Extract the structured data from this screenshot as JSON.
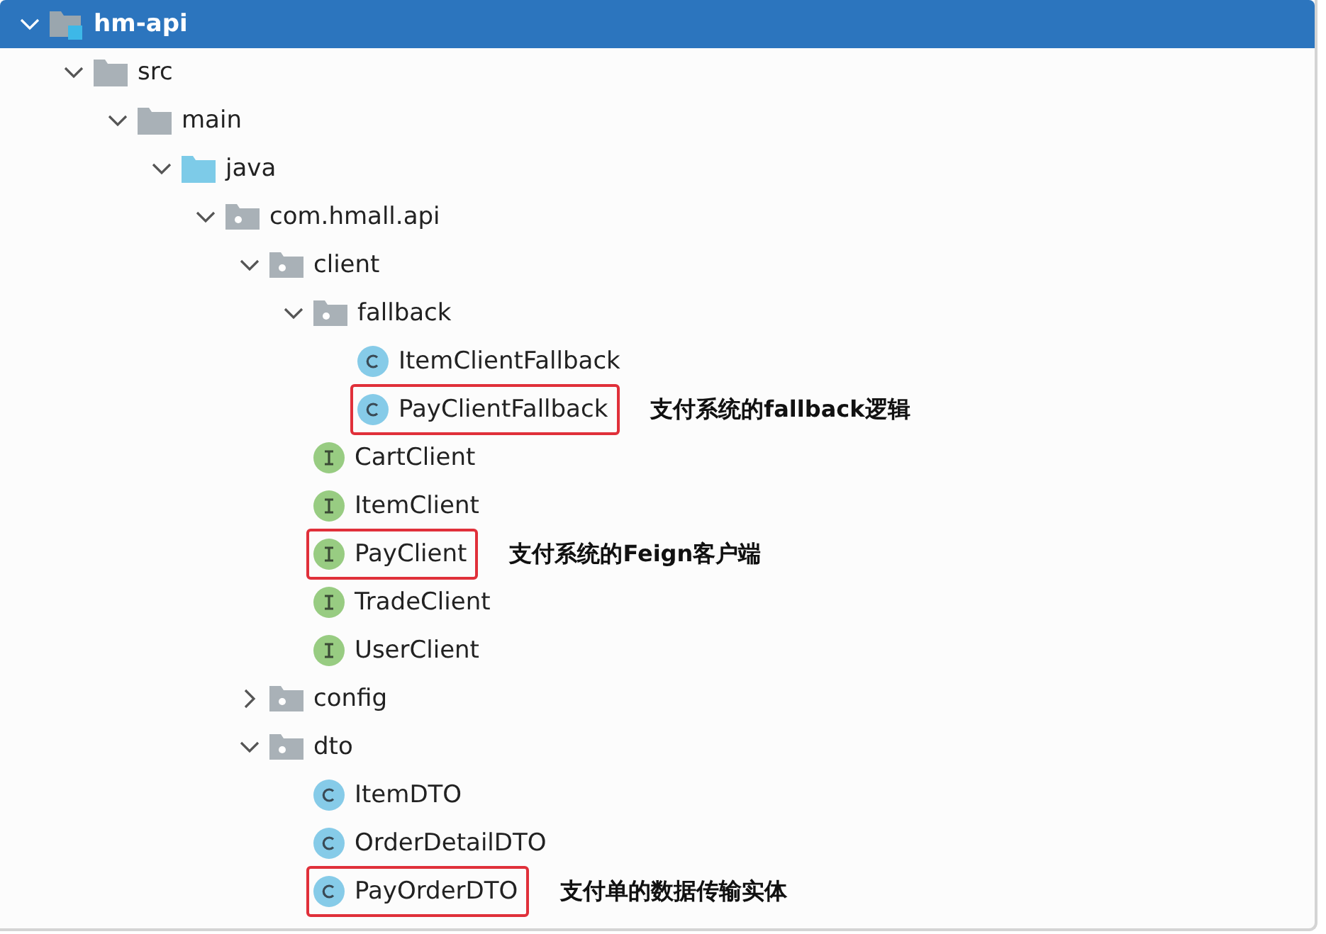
{
  "tree": [
    {
      "label": "hm-api",
      "kind": "module",
      "expanded": true,
      "selected": true,
      "children": [
        {
          "label": "src",
          "kind": "folder",
          "expanded": true,
          "selected": false,
          "children": [
            {
              "label": "main",
              "kind": "folder",
              "expanded": true,
              "selected": false,
              "children": [
                {
                  "label": "java",
                  "kind": "source",
                  "expanded": true,
                  "selected": false,
                  "children": [
                    {
                      "label": "com.hmall.api",
                      "kind": "package",
                      "expanded": true,
                      "selected": false,
                      "children": [
                        {
                          "label": "client",
                          "kind": "package",
                          "expanded": true,
                          "selected": false,
                          "children": [
                            {
                              "label": "fallback",
                              "kind": "package",
                              "expanded": true,
                              "selected": false,
                              "children": [
                                {
                                  "label": "ItemClientFallback",
                                  "kind": "class",
                                  "selected": false,
                                  "highlighted": false
                                },
                                {
                                  "label": "PayClientFallback",
                                  "kind": "class",
                                  "selected": false,
                                  "highlighted": true,
                                  "note": "支付系统的fallback逻辑"
                                }
                              ]
                            },
                            {
                              "label": "CartClient",
                              "kind": "interface",
                              "selected": false,
                              "highlighted": false
                            },
                            {
                              "label": "ItemClient",
                              "kind": "interface",
                              "selected": false,
                              "highlighted": false
                            },
                            {
                              "label": "PayClient",
                              "kind": "interface",
                              "selected": false,
                              "highlighted": true,
                              "note": "支付系统的Feign客户端"
                            },
                            {
                              "label": "TradeClient",
                              "kind": "interface",
                              "selected": false,
                              "highlighted": false
                            },
                            {
                              "label": "UserClient",
                              "kind": "interface",
                              "selected": false,
                              "highlighted": false
                            }
                          ]
                        },
                        {
                          "label": "config",
                          "kind": "package",
                          "expanded": false,
                          "selected": false
                        },
                        {
                          "label": "dto",
                          "kind": "package",
                          "expanded": true,
                          "selected": false,
                          "children": [
                            {
                              "label": "ItemDTO",
                              "kind": "class",
                              "selected": false,
                              "highlighted": false
                            },
                            {
                              "label": "OrderDetailDTO",
                              "kind": "class",
                              "selected": false,
                              "highlighted": false
                            },
                            {
                              "label": "PayOrderDTO",
                              "kind": "class",
                              "selected": false,
                              "highlighted": true,
                              "note": "支付单的数据传输实体"
                            }
                          ]
                        }
                      ]
                    }
                  ]
                }
              ]
            }
          ]
        }
      ]
    }
  ]
}
